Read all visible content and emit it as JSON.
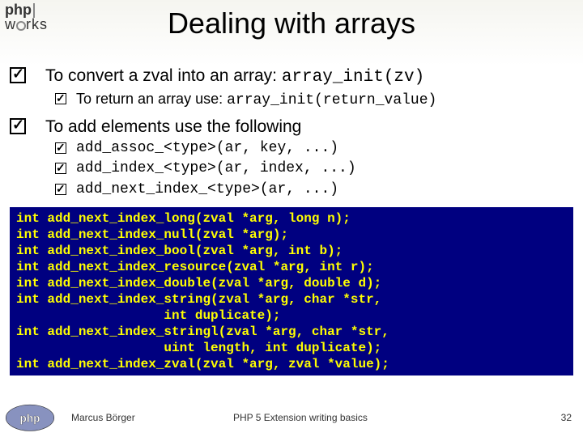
{
  "logo": {
    "line1": "php",
    "line2": "w",
    "line2b": "rks"
  },
  "title": "Dealing with arrays",
  "bullets": [
    {
      "text_a": "To convert a zval into an array: ",
      "text_b": "array_init(zv)",
      "subs": [
        {
          "text_a": "To return an array use: ",
          "text_b": "array_init(return_value)"
        }
      ]
    },
    {
      "text_a": "To add elements use the following",
      "text_b": "",
      "subs": [
        {
          "text_a": "",
          "text_b": "add_assoc_<type>(ar, key, ...)"
        },
        {
          "text_a": "",
          "text_b": "add_index_<type>(ar, index, ...)"
        },
        {
          "text_a": "",
          "text_b": "add_next_index_<type>(ar, ...)"
        }
      ]
    }
  ],
  "code": "int add_next_index_long(zval *arg, long n);\nint add_next_index_null(zval *arg);\nint add_next_index_bool(zval *arg, int b);\nint add_next_index_resource(zval *arg, int r);\nint add_next_index_double(zval *arg, double d);\nint add_next_index_string(zval *arg, char *str,\n                   int duplicate);\nint add_next_index_stringl(zval *arg, char *str,\n                   uint length, int duplicate);\nint add_next_index_zval(zval *arg, zval *value);",
  "footer": {
    "author": "Marcus Börger",
    "title": "PHP 5 Extension writing basics",
    "page": "32"
  }
}
